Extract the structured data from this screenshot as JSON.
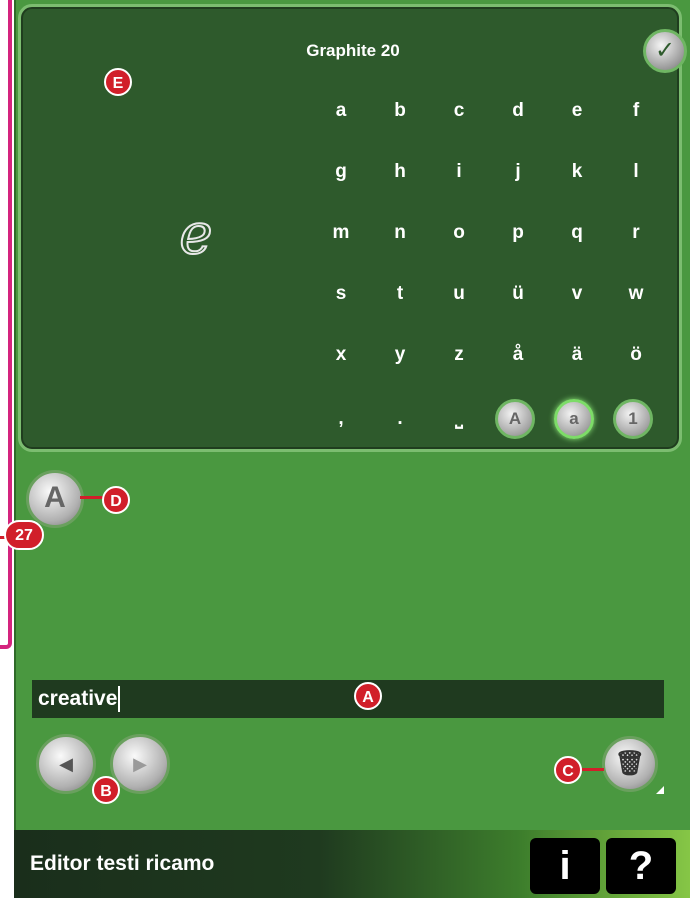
{
  "keyboard": {
    "font_name": "Graphite 20",
    "confirm_icon": "✓",
    "preview_char": "e",
    "rows": [
      [
        "a",
        "b",
        "c",
        "d",
        "e",
        "f"
      ],
      [
        "g",
        "h",
        "i",
        "j",
        "k",
        "l"
      ],
      [
        "m",
        "n",
        "o",
        "p",
        "q",
        "r"
      ],
      [
        "s",
        "t",
        "u",
        "ü",
        "v",
        "w"
      ],
      [
        "x",
        "y",
        "z",
        "å",
        "ä",
        "ö"
      ]
    ],
    "bottom_row": [
      ",",
      ".",
      "⎵"
    ],
    "case_buttons": [
      {
        "label": "A",
        "active": false
      },
      {
        "label": "a",
        "active": true
      },
      {
        "label": "1",
        "active": false
      }
    ]
  },
  "font_button": {
    "label": "A"
  },
  "text_field": {
    "value": "creative"
  },
  "nav": {
    "left_icon": "◀",
    "right_icon": "▶"
  },
  "delete_icon": "🗑",
  "status_bar": {
    "title": "Editor testi ricamo",
    "info_label": "i",
    "help_label": "?"
  },
  "callouts": {
    "A": "A",
    "B": "B",
    "C": "C",
    "D": "D",
    "E": "E",
    "ref": "27"
  },
  "colors": {
    "panel": "#2e5a2c",
    "background": "#4a9840",
    "callout": "#d11f2a",
    "accent": "#d4247e"
  }
}
